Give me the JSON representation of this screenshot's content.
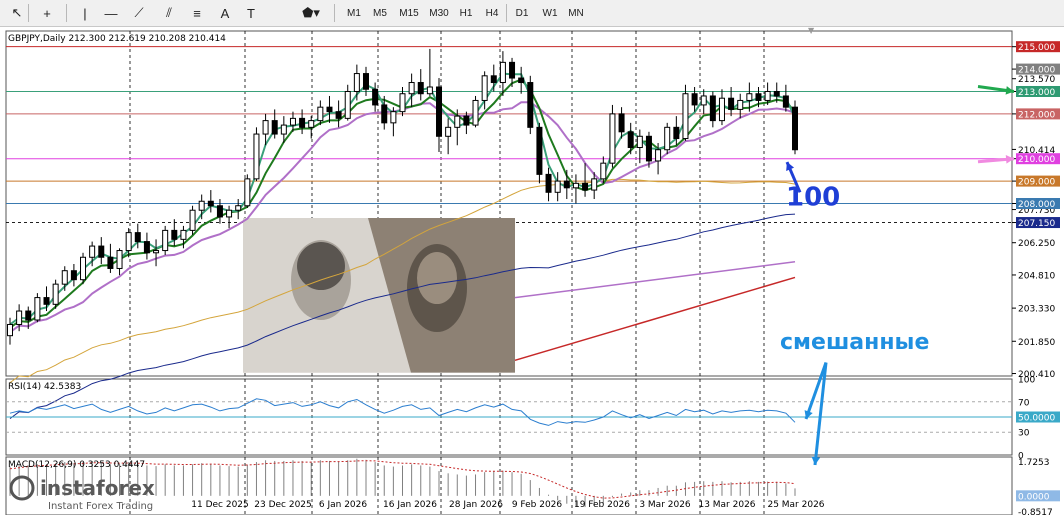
{
  "toolbar": {
    "tools": [
      {
        "name": "cursor-icon",
        "glyph": "↖"
      },
      {
        "name": "crosshair-icon",
        "glyph": "+"
      },
      {
        "name": "vertical-line-icon",
        "glyph": "|"
      },
      {
        "name": "horizontal-line-icon",
        "glyph": "—"
      },
      {
        "name": "trendline-icon",
        "glyph": "⟋"
      },
      {
        "name": "equidistant-channel-icon",
        "glyph": "⫽"
      },
      {
        "name": "fibonacci-icon",
        "glyph": "≡"
      },
      {
        "name": "text-tool-icon",
        "glyph": "A"
      },
      {
        "name": "text-label-icon",
        "glyph": "T"
      },
      {
        "name": "shapes-icon",
        "glyph": "⬟▾"
      }
    ],
    "timeframes": [
      "M1",
      "M5",
      "M15",
      "M30",
      "H1",
      "H4",
      "D1",
      "W1",
      "MN"
    ]
  },
  "chart_data": [
    {
      "type": "candlestick",
      "panel": "price",
      "title": "GBPJPY,Daily  212.300 212.619 210.208 210.414",
      "current_price": "210.414",
      "y_ticks": [
        "215.000",
        "214.000",
        "213.570",
        "213.000",
        "212.000",
        "210.414",
        "210.000",
        "209.000",
        "208.000",
        "207.730",
        "207.150",
        "206.250",
        "204.810",
        "203.330",
        "201.850",
        "200.410"
      ],
      "price_labels": [
        {
          "text": "215.000",
          "value": 215.0,
          "color": "#c62828"
        },
        {
          "text": "214.000",
          "value": 214.0,
          "color": "#808080"
        },
        {
          "text": "213.000",
          "value": 213.0,
          "color": "#2e9a72"
        },
        {
          "text": "212.000",
          "value": 212.0,
          "color": "#c86464"
        },
        {
          "text": "210.414",
          "value": 210.414,
          "color": "#ffffff"
        },
        {
          "text": "210.000",
          "value": 210.0,
          "color": "#e040e0"
        },
        {
          "text": "209.000",
          "value": 209.0,
          "color": "#c8782a"
        },
        {
          "text": "208.000",
          "value": 208.0,
          "color": "#3a7ab0"
        },
        {
          "text": "207.150",
          "value": 207.15,
          "color": "#1a2a8c"
        }
      ],
      "horizontal_levels": [
        {
          "value": 215.0,
          "color": "#c62828"
        },
        {
          "value": 213.0,
          "color": "#3aa07a"
        },
        {
          "value": 212.0,
          "color": "#c86464"
        },
        {
          "value": 210.0,
          "color": "#e040e0"
        },
        {
          "value": 209.0,
          "color": "#c8782a"
        },
        {
          "value": 208.0,
          "color": "#3a7ab0"
        }
      ],
      "x_labels": [
        "11 Dec 2025",
        "23 Dec 2025",
        "6 Jan 2026",
        "16 Jan 2026",
        "28 Jan 2026",
        "9 Feb 2026",
        "19 Feb 2026",
        "3 Mar 2026",
        "13 Mar 2026",
        "25 Mar 2026"
      ],
      "candles": [
        [
          202.1,
          202.9,
          201.7,
          202.6
        ],
        [
          202.6,
          203.5,
          202.3,
          203.2
        ],
        [
          203.2,
          203.4,
          202.4,
          202.8
        ],
        [
          202.8,
          204.0,
          202.7,
          203.8
        ],
        [
          203.8,
          204.3,
          203.2,
          203.5
        ],
        [
          203.5,
          204.6,
          203.3,
          204.4
        ],
        [
          204.4,
          205.2,
          204.1,
          205.0
        ],
        [
          205.0,
          205.3,
          204.3,
          204.6
        ],
        [
          204.6,
          205.8,
          204.4,
          205.6
        ],
        [
          205.6,
          206.3,
          205.2,
          206.1
        ],
        [
          206.1,
          206.5,
          205.3,
          205.6
        ],
        [
          205.6,
          206.2,
          204.9,
          205.1
        ],
        [
          205.1,
          206.0,
          204.8,
          205.9
        ],
        [
          205.9,
          206.9,
          205.6,
          206.7
        ],
        [
          206.7,
          207.1,
          206.0,
          206.3
        ],
        [
          206.3,
          206.7,
          205.5,
          205.8
        ],
        [
          205.8,
          206.4,
          205.2,
          205.9
        ],
        [
          205.9,
          207.0,
          205.7,
          206.8
        ],
        [
          206.8,
          207.3,
          206.1,
          206.4
        ],
        [
          206.4,
          207.0,
          206.0,
          206.8
        ],
        [
          206.8,
          207.9,
          206.6,
          207.7
        ],
        [
          207.7,
          208.4,
          207.3,
          208.1
        ],
        [
          208.1,
          208.6,
          207.6,
          207.9
        ],
        [
          207.9,
          208.2,
          207.1,
          207.4
        ],
        [
          207.4,
          207.9,
          206.9,
          207.7
        ],
        [
          207.7,
          208.2,
          207.3,
          207.9
        ],
        [
          207.9,
          209.3,
          207.8,
          209.1
        ],
        [
          209.1,
          211.4,
          209.0,
          211.1
        ],
        [
          211.1,
          212.0,
          210.6,
          211.7
        ],
        [
          211.7,
          212.2,
          210.9,
          211.1
        ],
        [
          211.1,
          211.9,
          210.7,
          211.5
        ],
        [
          211.5,
          212.1,
          211.2,
          211.8
        ],
        [
          211.8,
          212.2,
          211.1,
          211.4
        ],
        [
          211.4,
          211.9,
          210.9,
          211.7
        ],
        [
          211.7,
          212.6,
          211.5,
          212.3
        ],
        [
          212.3,
          212.8,
          211.6,
          212.1
        ],
        [
          212.1,
          212.6,
          211.4,
          211.8
        ],
        [
          211.8,
          213.3,
          211.7,
          213.0
        ],
        [
          213.0,
          214.2,
          212.6,
          213.8
        ],
        [
          213.8,
          214.1,
          212.8,
          213.1
        ],
        [
          213.1,
          213.4,
          212.1,
          212.4
        ],
        [
          212.4,
          212.8,
          211.3,
          211.6
        ],
        [
          211.6,
          212.3,
          211.0,
          212.1
        ],
        [
          212.1,
          213.2,
          211.9,
          212.9
        ],
        [
          212.9,
          213.8,
          212.3,
          213.4
        ],
        [
          213.4,
          214.0,
          212.6,
          212.9
        ],
        [
          212.9,
          214.9,
          212.8,
          213.2
        ],
        [
          213.2,
          213.6,
          210.3,
          211.0
        ],
        [
          211.0,
          211.8,
          210.2,
          211.4
        ],
        [
          211.4,
          212.2,
          210.6,
          211.9
        ],
        [
          211.9,
          212.1,
          211.1,
          211.5
        ],
        [
          211.5,
          212.8,
          211.4,
          212.6
        ],
        [
          212.6,
          213.9,
          212.2,
          213.7
        ],
        [
          213.7,
          214.2,
          213.0,
          213.4
        ],
        [
          213.4,
          214.8,
          212.8,
          214.3
        ],
        [
          214.3,
          214.5,
          213.2,
          213.6
        ],
        [
          213.6,
          214.1,
          212.9,
          213.4
        ],
        [
          213.4,
          213.7,
          211.1,
          211.4
        ],
        [
          211.4,
          211.6,
          208.9,
          209.3
        ],
        [
          209.3,
          209.6,
          208.1,
          208.5
        ],
        [
          208.5,
          209.4,
          208.1,
          209.0
        ],
        [
          209.0,
          209.5,
          208.2,
          208.7
        ],
        [
          208.7,
          209.3,
          208.0,
          208.9
        ],
        [
          208.9,
          209.8,
          208.3,
          208.6
        ],
        [
          208.6,
          209.4,
          208.2,
          209.1
        ],
        [
          209.1,
          210.1,
          208.9,
          209.8
        ],
        [
          209.8,
          212.4,
          209.6,
          212.0
        ],
        [
          212.0,
          212.3,
          210.9,
          211.2
        ],
        [
          211.2,
          211.6,
          210.2,
          210.5
        ],
        [
          210.5,
          211.3,
          209.8,
          211.0
        ],
        [
          211.0,
          211.2,
          209.6,
          209.9
        ],
        [
          209.9,
          210.7,
          209.3,
          210.4
        ],
        [
          210.4,
          211.6,
          210.2,
          211.4
        ],
        [
          211.4,
          211.9,
          210.6,
          210.9
        ],
        [
          210.9,
          213.3,
          210.8,
          212.9
        ],
        [
          212.9,
          213.2,
          212.1,
          212.4
        ],
        [
          212.4,
          213.1,
          212.0,
          212.8
        ],
        [
          212.8,
          213.0,
          211.4,
          211.7
        ],
        [
          211.7,
          213.1,
          211.5,
          212.7
        ],
        [
          212.7,
          213.2,
          211.9,
          212.2
        ],
        [
          212.2,
          212.9,
          211.8,
          212.6
        ],
        [
          212.6,
          213.4,
          212.1,
          212.9
        ],
        [
          212.9,
          213.2,
          212.3,
          212.6
        ],
        [
          212.6,
          213.4,
          212.4,
          213.0
        ],
        [
          213.0,
          213.4,
          212.5,
          212.8
        ],
        [
          212.8,
          213.3,
          212.1,
          212.3
        ],
        [
          212.3,
          212.6,
          210.2,
          210.4
        ]
      ],
      "ma_fast_color": "#3aa07a",
      "ma_mid_color": "#1e7a1e",
      "ma_slow_color": "#b070c8",
      "ma_long_color": "#d4a53c",
      "ma_200_color": "#1a2a8c",
      "overlay_lines": [
        {
          "color": "#b070c8",
          "from": 203.8,
          "to": 205.4
        },
        {
          "color": "#c62828",
          "from": 201.0,
          "to": 204.7
        }
      ],
      "annotation": "100",
      "annotation_color": "#1f3fd6",
      "inset_image": "GBP / JPY banknotes (Queen portrait and Japanese banknote portrait)"
    },
    {
      "type": "line",
      "panel": "rsi",
      "title": "RSI(14) 42.5383",
      "y_ticks": [
        "100",
        "70",
        "50.0000",
        "30",
        "0"
      ],
      "levels": [
        70,
        50,
        30
      ],
      "level_label": "50.0000",
      "color": "#2b7ecf",
      "values": [
        55,
        58,
        56,
        62,
        60,
        63,
        66,
        61,
        64,
        67,
        60,
        56,
        60,
        64,
        58,
        54,
        56,
        62,
        58,
        62,
        66,
        67,
        63,
        58,
        61,
        62,
        68,
        74,
        72,
        65,
        67,
        69,
        64,
        66,
        70,
        65,
        62,
        70,
        73,
        66,
        60,
        55,
        59,
        64,
        66,
        60,
        62,
        52,
        56,
        60,
        57,
        62,
        66,
        63,
        67,
        60,
        58,
        47,
        42,
        39,
        44,
        42,
        44,
        43,
        46,
        50,
        58,
        53,
        49,
        53,
        48,
        52,
        56,
        52,
        60,
        57,
        59,
        54,
        58,
        56,
        58,
        59,
        57,
        59,
        58,
        55,
        43
      ],
      "annotation": "смешанные",
      "annotation_color": "#1f8fe0"
    },
    {
      "type": "bar",
      "panel": "macd",
      "title": "MACD(12,26,9) 0.3253 0.4447",
      "y_ticks": [
        "1.7253",
        "0.0000",
        "-0.8517"
      ],
      "level_label": "0.0000",
      "bar_color": "#808080",
      "signal_color": "#c62828",
      "values": [
        1.3,
        1.35,
        1.35,
        1.4,
        1.4,
        1.45,
        1.5,
        1.45,
        1.5,
        1.55,
        1.5,
        1.4,
        1.42,
        1.5,
        1.42,
        1.35,
        1.32,
        1.4,
        1.35,
        1.35,
        1.4,
        1.45,
        1.42,
        1.35,
        1.32,
        1.3,
        1.38,
        1.5,
        1.58,
        1.55,
        1.55,
        1.58,
        1.55,
        1.52,
        1.58,
        1.55,
        1.52,
        1.58,
        1.65,
        1.6,
        1.5,
        1.35,
        1.3,
        1.35,
        1.4,
        1.35,
        1.3,
        1.1,
        1.0,
        0.95,
        0.9,
        0.95,
        1.05,
        1.08,
        1.12,
        1.05,
        0.98,
        0.7,
        0.35,
        0.05,
        -0.2,
        -0.35,
        -0.45,
        -0.5,
        -0.45,
        -0.35,
        -0.05,
        0.1,
        0.15,
        0.25,
        0.25,
        0.35,
        0.45,
        0.45,
        0.6,
        0.62,
        0.65,
        0.62,
        0.65,
        0.6,
        0.62,
        0.65,
        0.62,
        0.63,
        0.62,
        0.55,
        0.33
      ],
      "signal": [
        1.2,
        1.25,
        1.3,
        1.33,
        1.35,
        1.38,
        1.41,
        1.42,
        1.44,
        1.47,
        1.47,
        1.46,
        1.45,
        1.46,
        1.45,
        1.43,
        1.41,
        1.41,
        1.4,
        1.39,
        1.39,
        1.4,
        1.41,
        1.4,
        1.38,
        1.36,
        1.37,
        1.39,
        1.43,
        1.45,
        1.47,
        1.49,
        1.5,
        1.5,
        1.51,
        1.52,
        1.52,
        1.53,
        1.55,
        1.56,
        1.55,
        1.51,
        1.47,
        1.45,
        1.44,
        1.42,
        1.4,
        1.34,
        1.27,
        1.21,
        1.15,
        1.11,
        1.1,
        1.09,
        1.09,
        1.08,
        1.06,
        0.99,
        0.86,
        0.7,
        0.52,
        0.35,
        0.19,
        0.06,
        -0.04,
        -0.1,
        -0.09,
        -0.05,
        0.0,
        0.05,
        0.09,
        0.14,
        0.2,
        0.25,
        0.32,
        0.38,
        0.43,
        0.47,
        0.51,
        0.53,
        0.55,
        0.57,
        0.58,
        0.59,
        0.6,
        0.59,
        0.54
      ]
    }
  ],
  "watermark": {
    "brand": "instaforex",
    "tagline": "Instant Forex Trading"
  }
}
